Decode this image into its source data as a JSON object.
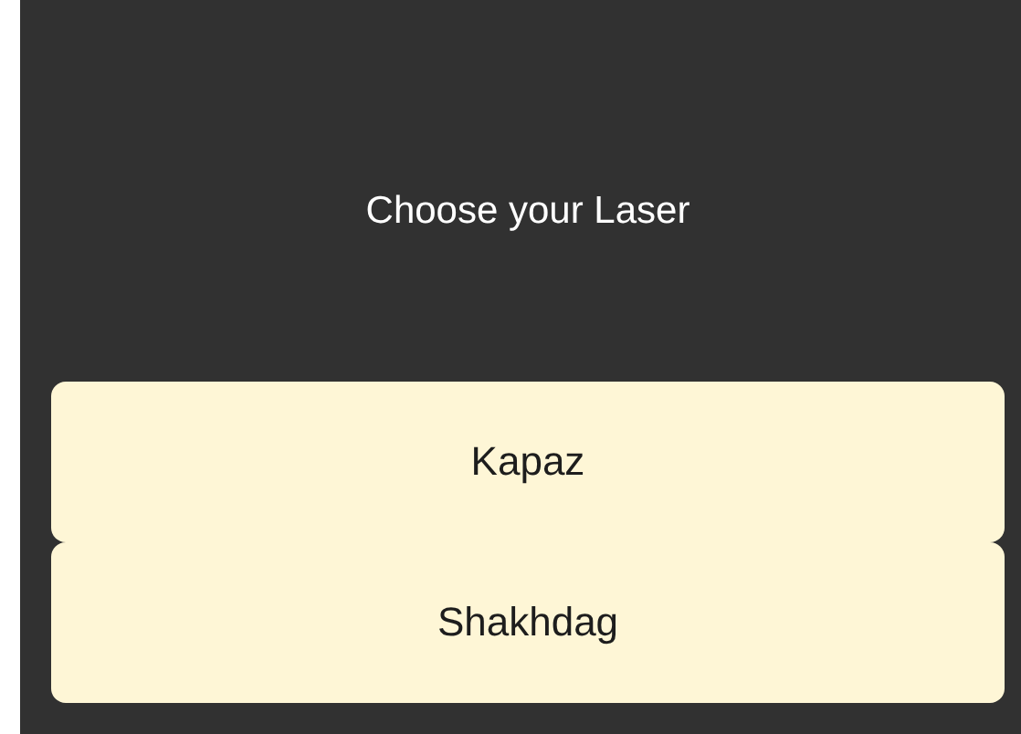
{
  "title": "Choose your Laser",
  "options": [
    {
      "label": "Kapaz"
    },
    {
      "label": "Shakhdag"
    }
  ]
}
